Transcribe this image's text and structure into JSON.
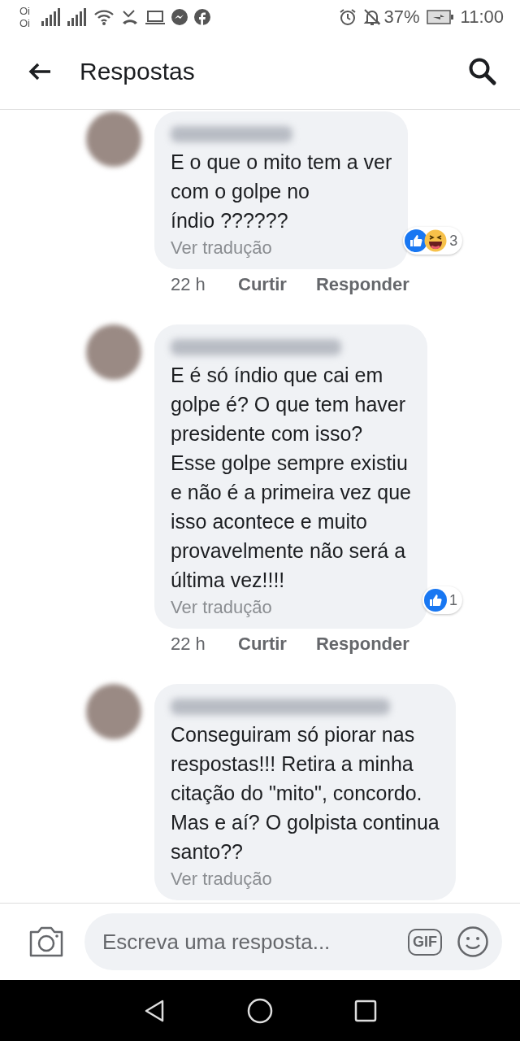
{
  "status_bar": {
    "carriers": [
      "Oi",
      "Oi"
    ],
    "battery": "37%",
    "time": "11:00"
  },
  "header": {
    "title": "Respostas"
  },
  "comments": [
    {
      "text": "E o que o mito tem a ver\ncom o golpe no\níndio ??????",
      "translate": "Ver tradução",
      "reactions": {
        "icons": [
          {
            "kind": "like"
          },
          {
            "kind": "haha"
          }
        ],
        "count": "3"
      },
      "time": "22 h",
      "actions": [
        "Curtir",
        "Responder"
      ]
    },
    {
      "text": "E é só índio que cai em\ngolpe é? O que tem haver\npresidente com isso?\nEsse golpe sempre existiu\ne não é a primeira vez que\nisso acontece e muito\nprovavelmente não será a\núltima vez!!!!",
      "translate": "Ver tradução",
      "reactions": {
        "icons": [
          {
            "kind": "like"
          }
        ],
        "count": "1"
      },
      "time": "22 h",
      "actions": [
        "Curtir",
        "Responder"
      ]
    },
    {
      "text": "Conseguiram só piorar nas\nrespostas!!! Retira a minha\ncitação do \"mito\", concordo.\nMas e aí? O golpista continua\nsanto??",
      "translate": "Ver tradução"
    }
  ],
  "composer": {
    "placeholder": "Escreva uma resposta...",
    "gif": "GIF"
  }
}
